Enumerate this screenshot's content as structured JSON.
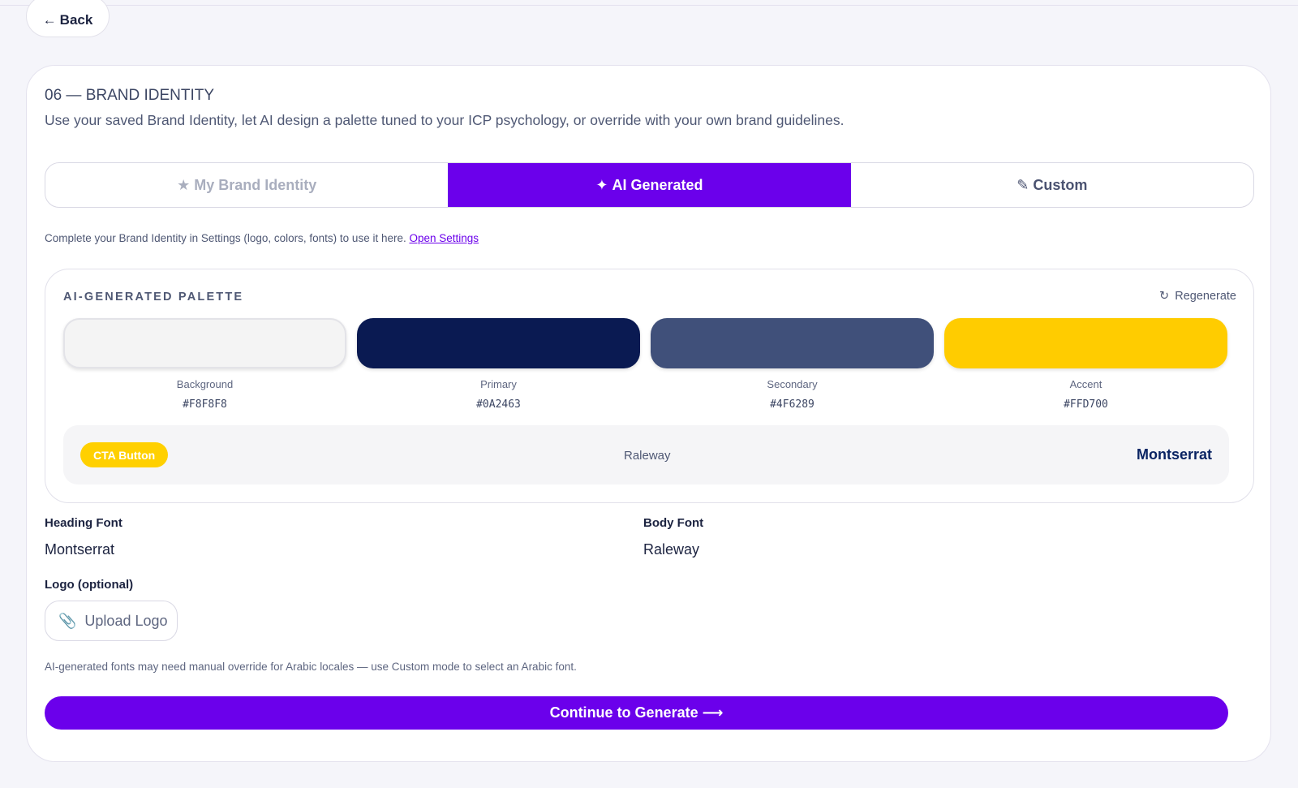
{
  "back": {
    "arrow": "←",
    "label": "Back"
  },
  "section": {
    "title": "06 — BRAND IDENTITY",
    "description": "Use your saved Brand Identity, let AI design a palette tuned to your ICP psychology, or override with your own brand guidelines."
  },
  "tabs": [
    {
      "icon": "★",
      "icon_name": "star-icon",
      "label": "My Brand Identity",
      "state": "disabled"
    },
    {
      "icon": "✦",
      "icon_name": "sparkle-icon",
      "label": "AI Generated",
      "state": "active"
    },
    {
      "icon": "✎",
      "icon_name": "pencil-icon",
      "label": "Custom",
      "state": "normal"
    }
  ],
  "hint": {
    "text": "Complete your Brand Identity in Settings (logo, colors, fonts) to use it here. ",
    "link": "Open Settings"
  },
  "palette": {
    "title": "AI-GENERATED PALETTE",
    "regenerate_icon": "↻",
    "regenerate_label": "Regenerate",
    "swatches": [
      {
        "name": "Background",
        "hex": "#F8F8F8",
        "color": "#f4f4f4"
      },
      {
        "name": "Primary",
        "hex": "#0A2463",
        "color": "#0a1a52"
      },
      {
        "name": "Secondary",
        "hex": "#4F6289",
        "color": "#40507a"
      },
      {
        "name": "Accent",
        "hex": "#FFD700",
        "color": "#ffcc00"
      }
    ],
    "preview": {
      "cta_label": "CTA Button",
      "body_font": "Raleway",
      "heading_font": "Montserrat"
    }
  },
  "fonts": {
    "heading_label": "Heading Font",
    "heading_value": "Montserrat",
    "body_label": "Body Font",
    "body_value": "Raleway"
  },
  "logo": {
    "label": "Logo (optional)",
    "upload_icon": "📎",
    "upload_label": "Upload Logo"
  },
  "note": "AI-generated fonts may need manual override for Arabic locales — use Custom mode to select an Arabic font.",
  "continue": {
    "label": "Continue to Generate",
    "arrow": "⟶"
  },
  "colors": {
    "accent": "#6b00eb",
    "page_bg": "#f5f5fa"
  }
}
